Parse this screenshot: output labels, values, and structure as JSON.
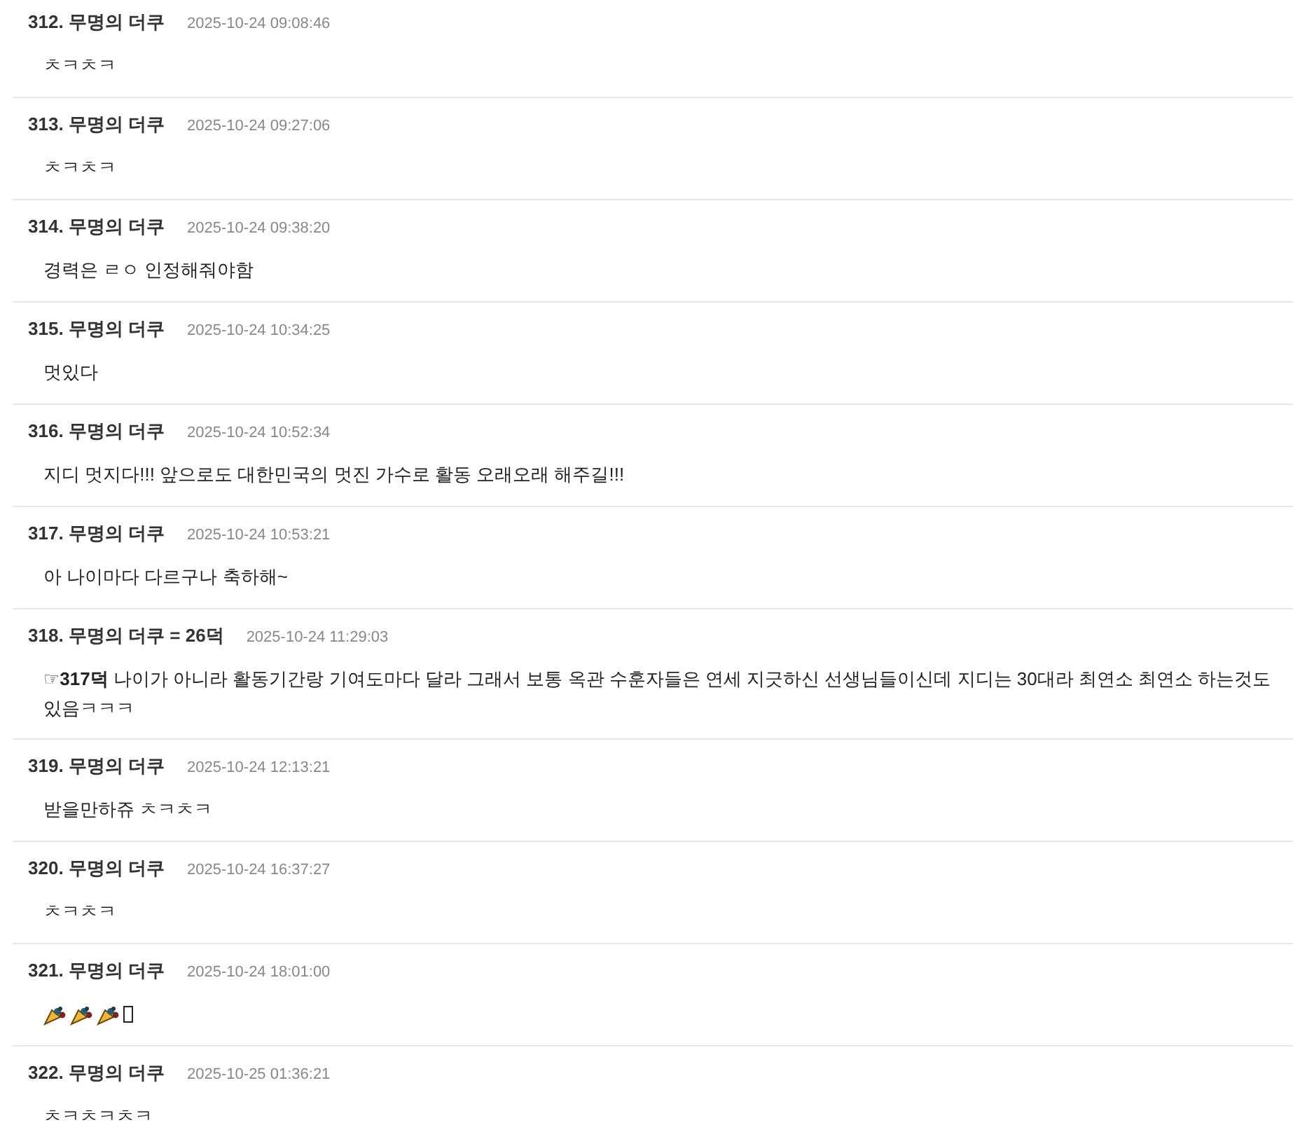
{
  "comments": [
    {
      "number": "312.",
      "author": "무명의 더쿠",
      "date": "2025-10-24 09:08:46",
      "text": "ㅊㅋㅊㅋ"
    },
    {
      "number": "313.",
      "author": "무명의 더쿠",
      "date": "2025-10-24 09:27:06",
      "text": "ㅊㅋㅊㅋ"
    },
    {
      "number": "314.",
      "author": "무명의 더쿠",
      "date": "2025-10-24 09:38:20",
      "text": "경력은 ㄹㅇ 인정해줘야함"
    },
    {
      "number": "315.",
      "author": "무명의 더쿠",
      "date": "2025-10-24 10:34:25",
      "text": "멋있다"
    },
    {
      "number": "316.",
      "author": "무명의 더쿠",
      "date": "2025-10-24 10:52:34",
      "text": "지디 멋지다!!! 앞으로도 대한민국의 멋진 가수로 활동 오래오래 해주길!!!"
    },
    {
      "number": "317.",
      "author": "무명의 더쿠",
      "date": "2025-10-24 10:53:21",
      "text": "아 나이마다 다르구나 축하해~"
    },
    {
      "number": "318.",
      "author": "무명의 더쿠 = 26덕",
      "date": "2025-10-24 11:29:03",
      "text": "☞**317덕** 나이가 아니라 활동기간랑 기여도마다 달라 그래서 보통 옥관 수훈자들은 연세 지긋하신 선생님들이신데 지디는 30대라 최연소 최연소 하는것도 있음ㅋㅋㅋ"
    },
    {
      "number": "319.",
      "author": "무명의 더쿠",
      "date": "2025-10-24 12:13:21",
      "text": "받을만하쥬 ㅊㅋㅊㅋ"
    },
    {
      "number": "320.",
      "author": "무명의 더쿠",
      "date": "2025-10-24 16:37:27",
      "text": "ㅊㅋㅊㅋ"
    },
    {
      "number": "321.",
      "author": "무명의 더쿠",
      "date": "2025-10-24 18:01:00",
      "icons": [
        {
          "kind": "popper"
        },
        {
          "kind": "popper"
        },
        {
          "kind": "popper"
        },
        {
          "kind": "missing"
        }
      ]
    },
    {
      "number": "322.",
      "author": "무명의 더쿠",
      "date": "2025-10-25 01:36:21",
      "text": "ㅊㅋㅊㅋㅊㅋ"
    }
  ]
}
